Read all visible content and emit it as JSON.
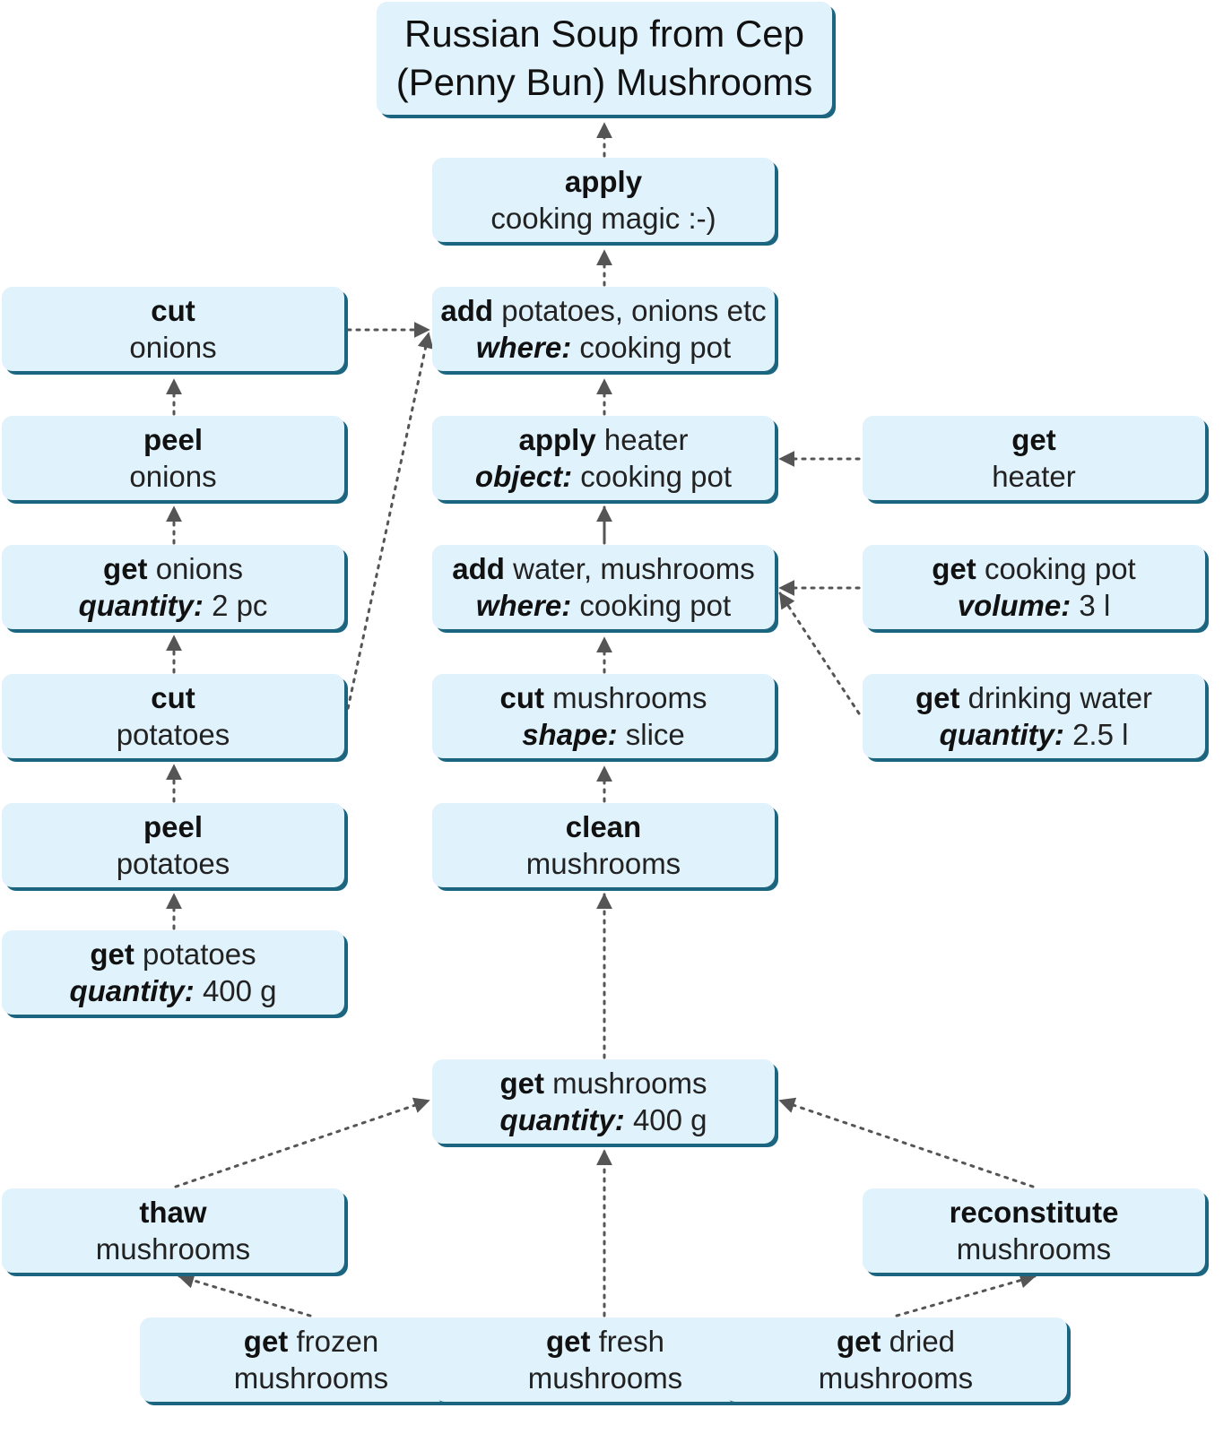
{
  "title": {
    "line1": "Russian Soup from Cep",
    "line2": "(Penny Bun) Mushrooms"
  },
  "colors": {
    "box_fill": "#e0f2fc",
    "box_shadow": "#1b6580",
    "edge": "#555555"
  },
  "nodes": {
    "apply_magic": {
      "verb": "apply",
      "object": "cooking magic :-)"
    },
    "add_potatoes": {
      "verb": "add",
      "object": "potatoes, onions etc",
      "key": "where:",
      "value": "cooking pot"
    },
    "apply_heater": {
      "verb": "apply",
      "object": "heater",
      "key": "object:",
      "value": "cooking pot"
    },
    "add_water": {
      "verb": "add",
      "object": "water, mushrooms",
      "key": "where:",
      "value": "cooking pot"
    },
    "cut_mushrooms": {
      "verb": "cut",
      "object": "mushrooms",
      "key": "shape:",
      "value": "slice"
    },
    "clean_mushrooms": {
      "verb": "clean",
      "object": "mushrooms"
    },
    "get_mushrooms": {
      "verb": "get",
      "object": "mushrooms",
      "key": "quantity:",
      "value": "400 g"
    },
    "cut_onions": {
      "verb": "cut",
      "object": "onions"
    },
    "peel_onions": {
      "verb": "peel",
      "object": "onions"
    },
    "get_onions": {
      "verb": "get",
      "object": "onions",
      "key": "quantity:",
      "value": "2 pc"
    },
    "cut_potatoes": {
      "verb": "cut",
      "object": "potatoes"
    },
    "peel_potatoes": {
      "verb": "peel",
      "object": "potatoes"
    },
    "get_potatoes": {
      "verb": "get",
      "object": "potatoes",
      "key": "quantity:",
      "value": "400 g"
    },
    "get_heater": {
      "verb": "get",
      "object": "heater"
    },
    "get_pot": {
      "verb": "get",
      "object": "cooking pot",
      "key": "volume:",
      "value": "3 l"
    },
    "get_water": {
      "verb": "get",
      "object": "drinking water",
      "key": "quantity:",
      "value": "2.5 l"
    },
    "thaw": {
      "verb": "thaw",
      "object": "mushrooms"
    },
    "reconstitute": {
      "verb": "reconstitute",
      "object": "mushrooms"
    },
    "get_frozen": {
      "verb": "get",
      "object": "frozen",
      "object2": "mushrooms"
    },
    "get_fresh": {
      "verb": "get",
      "object": "fresh",
      "object2": "mushrooms"
    },
    "get_dried": {
      "verb": "get",
      "object": "dried",
      "object2": "mushrooms"
    }
  }
}
